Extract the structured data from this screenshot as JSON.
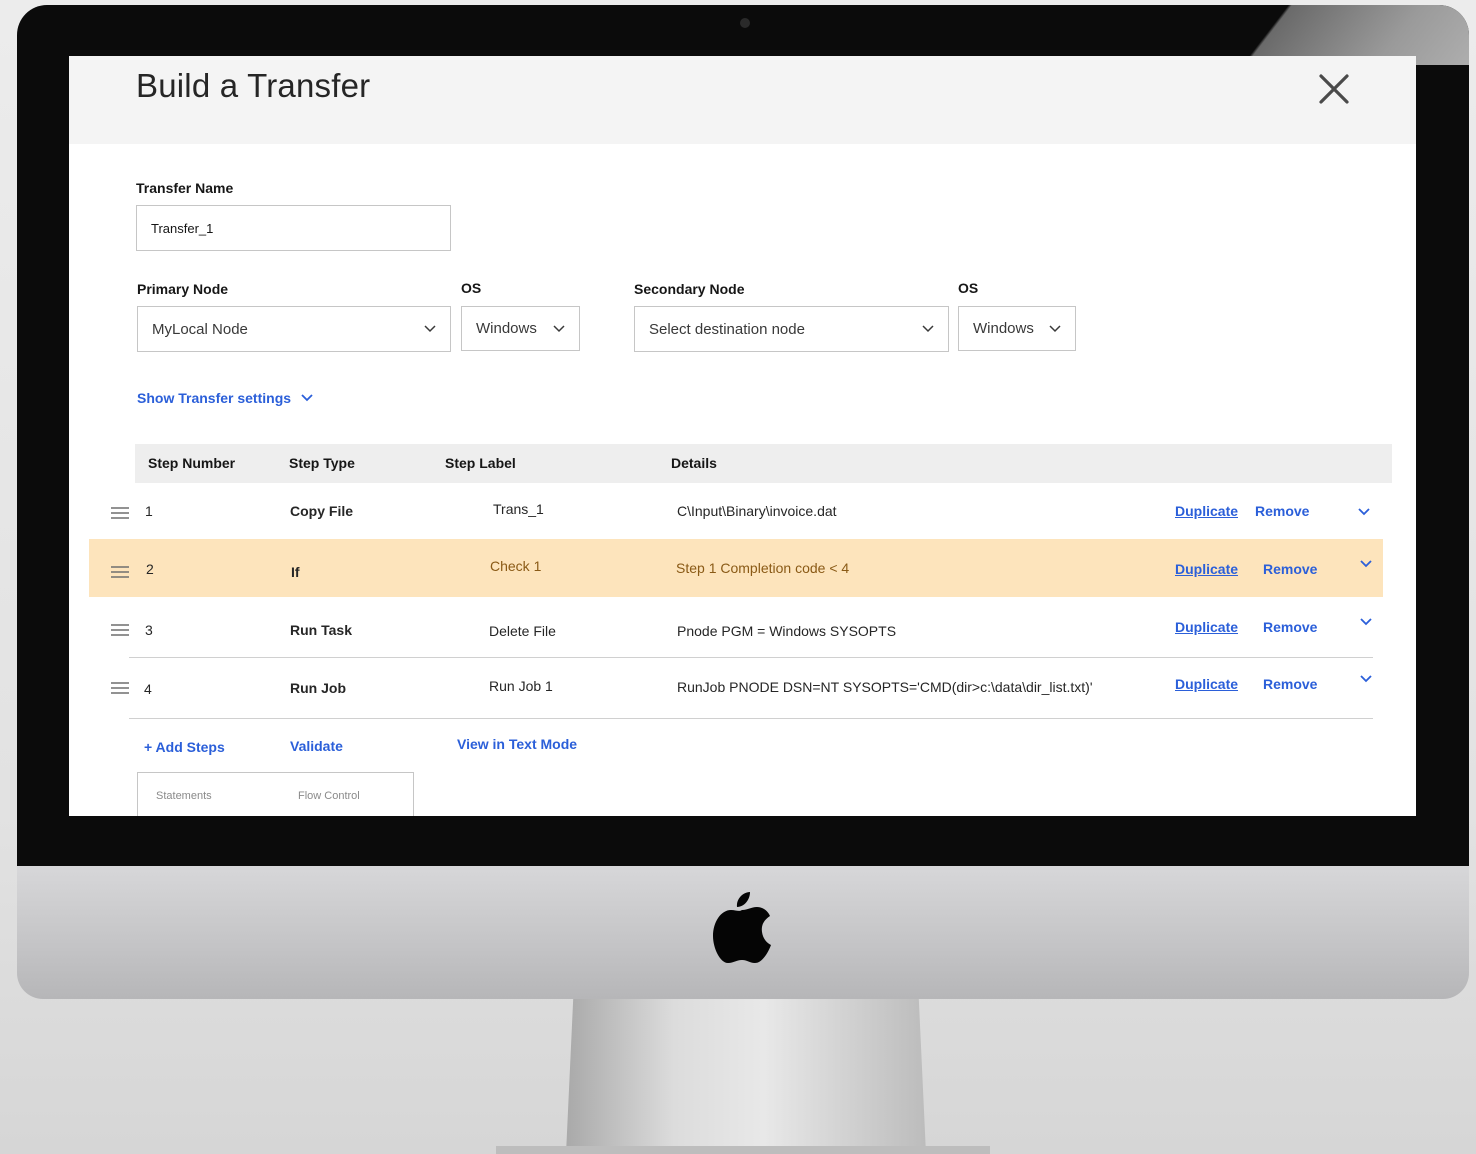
{
  "modal": {
    "title": "Build a Transfer"
  },
  "form": {
    "transfer_name_label": "Transfer Name",
    "transfer_name_value": "Transfer_1",
    "primary_node_label": "Primary Node",
    "primary_node_value": "MyLocal Node",
    "primary_os_label": "OS",
    "primary_os_value": "Windows",
    "secondary_node_label": "Secondary Node",
    "secondary_node_value": "Select destination node",
    "secondary_os_label": "OS",
    "secondary_os_value": "Windows",
    "settings_toggle": "Show Transfer settings"
  },
  "table": {
    "columns": [
      "Step Number",
      "Step Type",
      "Step Label",
      "Details"
    ],
    "rows": [
      {
        "number": "1",
        "type": "Copy File",
        "label": "Trans_1",
        "details": "C\\Input\\Binary\\invoice.dat",
        "duplicate": "Duplicate",
        "remove": "Remove"
      },
      {
        "number": "2",
        "type": "If",
        "label": "Check 1",
        "details": "Step 1 Completion code < 4",
        "duplicate": "Duplicate",
        "remove": "Remove"
      },
      {
        "number": "3",
        "type": "Run Task",
        "label": "Delete File",
        "details": "Pnode PGM = Windows SYSOPTS",
        "duplicate": "Duplicate",
        "remove": "Remove"
      },
      {
        "number": "4",
        "type": "Run Job",
        "label": "Run Job 1",
        "details": "RunJob PNODE DSN=NT SYSOPTS='CMD(dir>c:\\data\\dir_list.txt)'",
        "duplicate": "Duplicate",
        "remove": "Remove"
      }
    ],
    "highlight_color": "#fde4bc"
  },
  "actions": {
    "add_steps": "+ Add  Steps",
    "validate": "Validate",
    "text_mode": "View in Text Mode"
  },
  "tabs": [
    "Statements",
    "Flow Control"
  ],
  "colors": {
    "link": "#2b5fd9",
    "header_bg": "#f4f4f4"
  }
}
